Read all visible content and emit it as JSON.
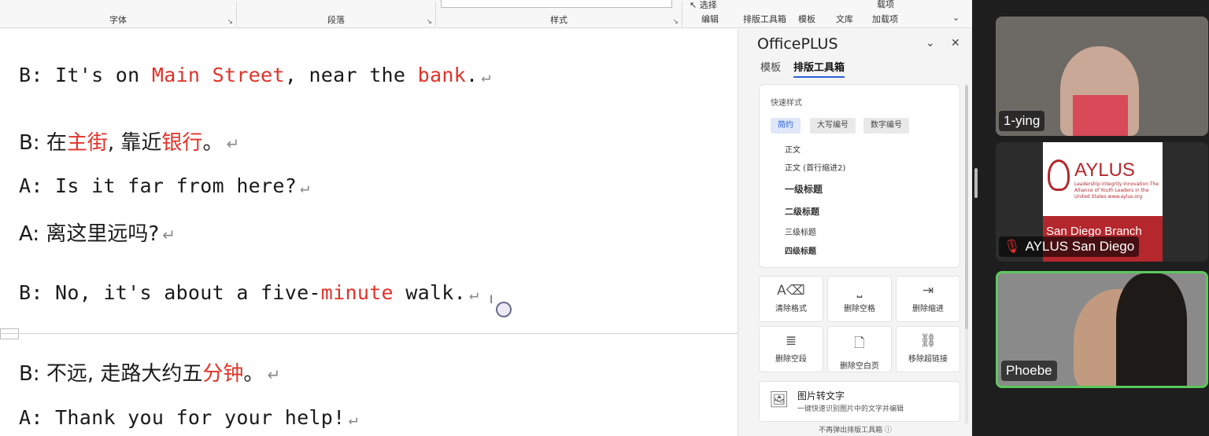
{
  "ribbon": {
    "groups": [
      "字体",
      "段落",
      "样式"
    ],
    "buttons": [
      "选择",
      "编辑",
      "排版工具箱",
      "模板",
      "文库",
      "载项",
      "加载项"
    ]
  },
  "document": {
    "lines": [
      {
        "segments": [
          {
            "t": "B: It's on "
          },
          {
            "t": "Main Street",
            "red": true
          },
          {
            "t": ", near the "
          },
          {
            "t": "bank",
            "red": true
          },
          {
            "t": "."
          }
        ]
      },
      {
        "segments": [
          {
            "t": "B: 在"
          },
          {
            "t": "主街",
            "red": true
          },
          {
            "t": ", 靠近"
          },
          {
            "t": "银行",
            "red": true
          },
          {
            "t": "。"
          }
        ],
        "cn": true
      },
      {
        "segments": [
          {
            "t": "A: Is it far from here?"
          }
        ]
      },
      {
        "segments": [
          {
            "t": "A: 离这里远吗?"
          }
        ],
        "cn": true
      },
      {
        "segments": [
          {
            "t": "B: No, it's about a five-"
          },
          {
            "t": "minute",
            "red": true
          },
          {
            "t": " walk."
          }
        ]
      },
      {
        "segments": [
          {
            "t": "B: 不远, 走路大约五"
          },
          {
            "t": "分钟",
            "red": true
          },
          {
            "t": "。"
          }
        ],
        "cn": true
      },
      {
        "segments": [
          {
            "t": "A: Thank you for your help!"
          }
        ]
      }
    ],
    "para_mark": "↵"
  },
  "panel": {
    "title": "OfficePLUS",
    "tabs": [
      "模板",
      "排版工具箱"
    ],
    "quick_styles_label": "快速样式",
    "style_chips": [
      "简约",
      "大写编号",
      "数字编号"
    ],
    "styles": [
      "正文",
      "正文 (首行缩进2)",
      "一级标题",
      "二级标题",
      "三级标题",
      "四级标题"
    ],
    "tools": [
      "清除格式",
      "删除空格",
      "删除缩进",
      "删除空段",
      "删除空白页",
      "移除超链接"
    ],
    "ocr_title": "图片转文字",
    "ocr_subtitle": "一键快速识别图片中的文字并编辑",
    "footer": "不再弹出排版工具箱 ⓘ"
  },
  "participants": [
    {
      "name": "1-ying"
    },
    {
      "name": "AYLUS San Diego",
      "muted": true,
      "logo_text": "AYLUS",
      "logo_sub": "Leadership Integrity Innovation The Alliance of Youth Leaders in the United States www.aylus.org",
      "logo_branch": "San Diego Branch"
    },
    {
      "name": "Phoebe",
      "speaking": true
    }
  ]
}
